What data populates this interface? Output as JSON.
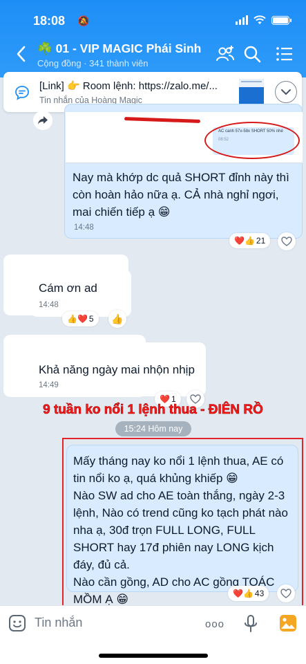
{
  "status_bar": {
    "time": "18:08"
  },
  "header": {
    "title": "☘️ 01 - VIP MAGIC Phái Sinh",
    "subtitle": "Cộng đồng · 341 thành viên",
    "icons": [
      "back-icon",
      "group-add-icon",
      "search-icon",
      "menu-icon"
    ]
  },
  "pinned": {
    "title": "[Link] 👉 Room lệnh: https://zalo.me/...",
    "subtitle": "Tin nhắn của Hoàng Magic"
  },
  "image_quote": {
    "quoted_text": "AC canh 57x-58x SHORT 50% nhé",
    "quoted_time": "08:52"
  },
  "messages": [
    {
      "side": "mine",
      "text": "Nay mà khớp dc quả SHORT đỉnh này thì còn hoàn hảo nữa ạ. CẢ nhà nghỉ ngơi, mai chiến tiếp ạ 😁",
      "time": "14:48",
      "reactions": "❤️👍",
      "reaction_count": "21"
    },
    {
      "side": "other",
      "text": "Cám ơn ad",
      "time": "14:48",
      "reactions": "👍❤️",
      "reaction_count": "5",
      "my_reaction": "👍"
    },
    {
      "side": "other",
      "text": "Khả năng ngày mai nhộn nhịp",
      "time": "14:49",
      "reactions": "❤️",
      "reaction_count": "1"
    },
    {
      "side": "mine",
      "lines": [
        "Mấy tháng nay ko nổi 1 lệnh thua, AE có tin nổi ko ạ, quá khủng khiếp 😁",
        "Nào SW ad cho AE toàn thắng, ngày 2-3 lệnh, Nào có trend cũng ko tạch phát nào nha ạ, 30đ trọn FULL LONG, FULL SHORT hay 17đ phiên nay LONG kịch đáy, đủ cả.",
        "Nào cần gồng, AD cho AC gồng TOÁC MỒM Ạ 😁"
      ],
      "reactions": "❤️👍",
      "reaction_count": "43"
    }
  ],
  "banner": "9 tuần ko nổi 1 lệnh thua - ĐIÊN RỒ",
  "date_divider": "15:24 Hôm nay",
  "input": {
    "placeholder": "Tin nhắn",
    "more": "ooo"
  },
  "colors": {
    "header": "#1e8ef7",
    "my_bubble": "#d9ecff",
    "banner_red": "#ff1a1a",
    "frame_red": "#e2242a"
  }
}
